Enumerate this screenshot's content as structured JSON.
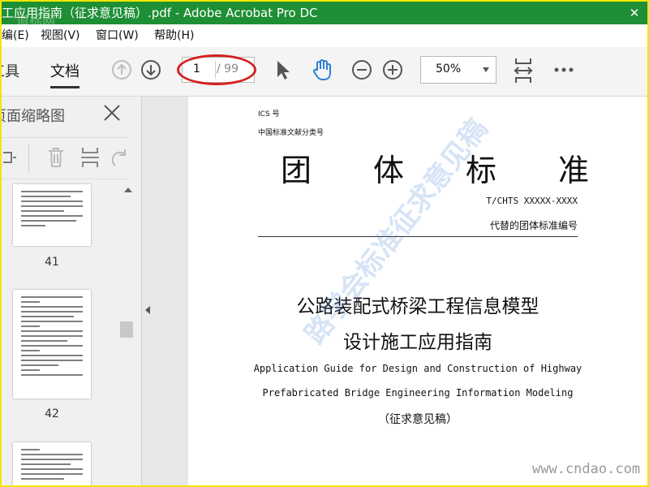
{
  "window": {
    "title": "工应用指南（征求意见稿）.pdf - Adobe Acrobat Pro DC",
    "close_label": "✕",
    "watermark_top": "道标网"
  },
  "menubar": {
    "items": [
      {
        "label": "编(E)"
      },
      {
        "label": "视图(V)"
      },
      {
        "label": "窗口(W)"
      },
      {
        "label": "帮助(H)"
      }
    ]
  },
  "toolbar": {
    "tabs": [
      {
        "label": "工具"
      },
      {
        "label": "文档"
      }
    ],
    "page_input": "1",
    "page_total": "/ 99",
    "zoom": "50%",
    "icons": [
      "arrow-up-circle-icon",
      "arrow-down-circle-icon",
      "pointer-icon",
      "hand-icon",
      "zoom-out-icon",
      "zoom-in-icon",
      "fit-page-icon",
      "more-icon"
    ]
  },
  "left_panel": {
    "title": "页面缩略图",
    "thumbnails": [
      {
        "label": "41"
      },
      {
        "label": "42"
      },
      {
        "label": ""
      }
    ]
  },
  "document": {
    "ics": "ICS 号",
    "classification": "中国标准文献分类号",
    "big_title_chars": [
      "团",
      "体",
      "标",
      "准"
    ],
    "code": "T/CHTS XXXXX-XXXX",
    "replace": "代替的团体标准编号",
    "title_cn_line1": "公路装配式桥梁工程信息模型",
    "title_cn_line2": "设计施工应用指南",
    "title_en_line1": "Application Guide for Design and Construction of Highway",
    "title_en_line2": "Prefabricated Bridge Engineering Information Modeling",
    "draft": "（征求意见稿）"
  },
  "watermarks": {
    "diagonal": "路学会标准征求意见稿",
    "url": "www.cndao.com"
  }
}
